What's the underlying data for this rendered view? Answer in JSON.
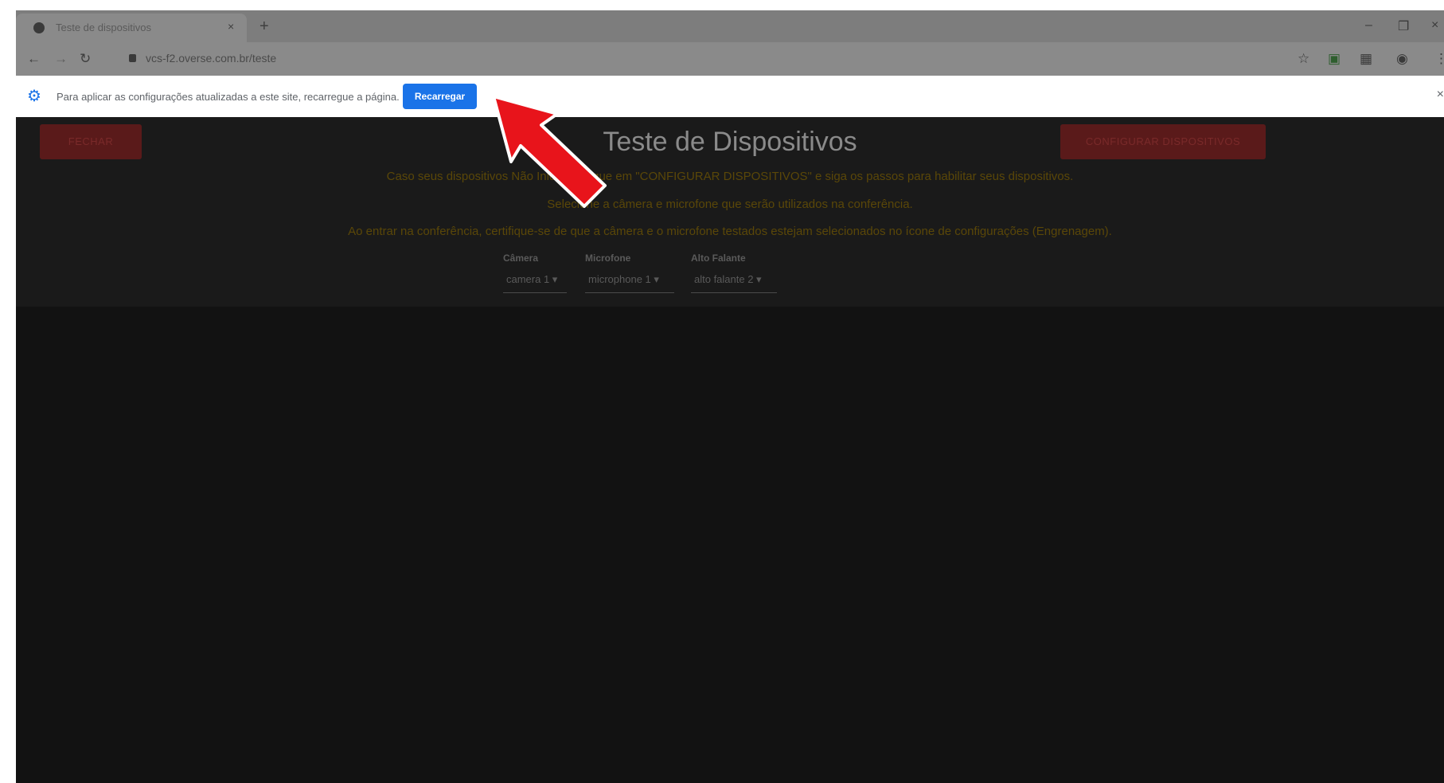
{
  "browser": {
    "tab_title": "Teste de dispositivos",
    "tab_close": "×",
    "new_tab": "+",
    "url": "vcs-f2.overse.com.br/teste",
    "win_min": "–",
    "win_max": "❐",
    "win_close": "×"
  },
  "infobar": {
    "message": "Para aplicar as configurações atualizadas a este site, recarregue a página.",
    "button": "Recarregar",
    "close": "×"
  },
  "page": {
    "close_button": "FECHAR",
    "config_button": "CONFIGURAR DISPOSITIVOS",
    "title": "Teste de Dispositivos",
    "instruction_1": "Caso seus dispositivos Não Iniciem, clique em \"CONFIGURAR DISPOSITIVOS\" e siga os passos para habilitar seus dispositivos.",
    "instruction_2": "Selecione a câmera e microfone que serão utilizados na conferência.",
    "instruction_3": "Ao entrar na conferência, certifique-se de que a câmera e o microfone testados estejam selecionados no ícone de configurações (Engrenagem).",
    "camera_label": "Câmera",
    "camera_value": "camera 1 ▾",
    "microphone_label": "Microfone",
    "microphone_value": "microphone 1 ▾",
    "speaker_label": "Alto Falante",
    "speaker_value": "alto falante 2 ▾"
  },
  "colors": {
    "infobar_button": "#1a73e8",
    "annotation_arrow": "#e8141b"
  }
}
